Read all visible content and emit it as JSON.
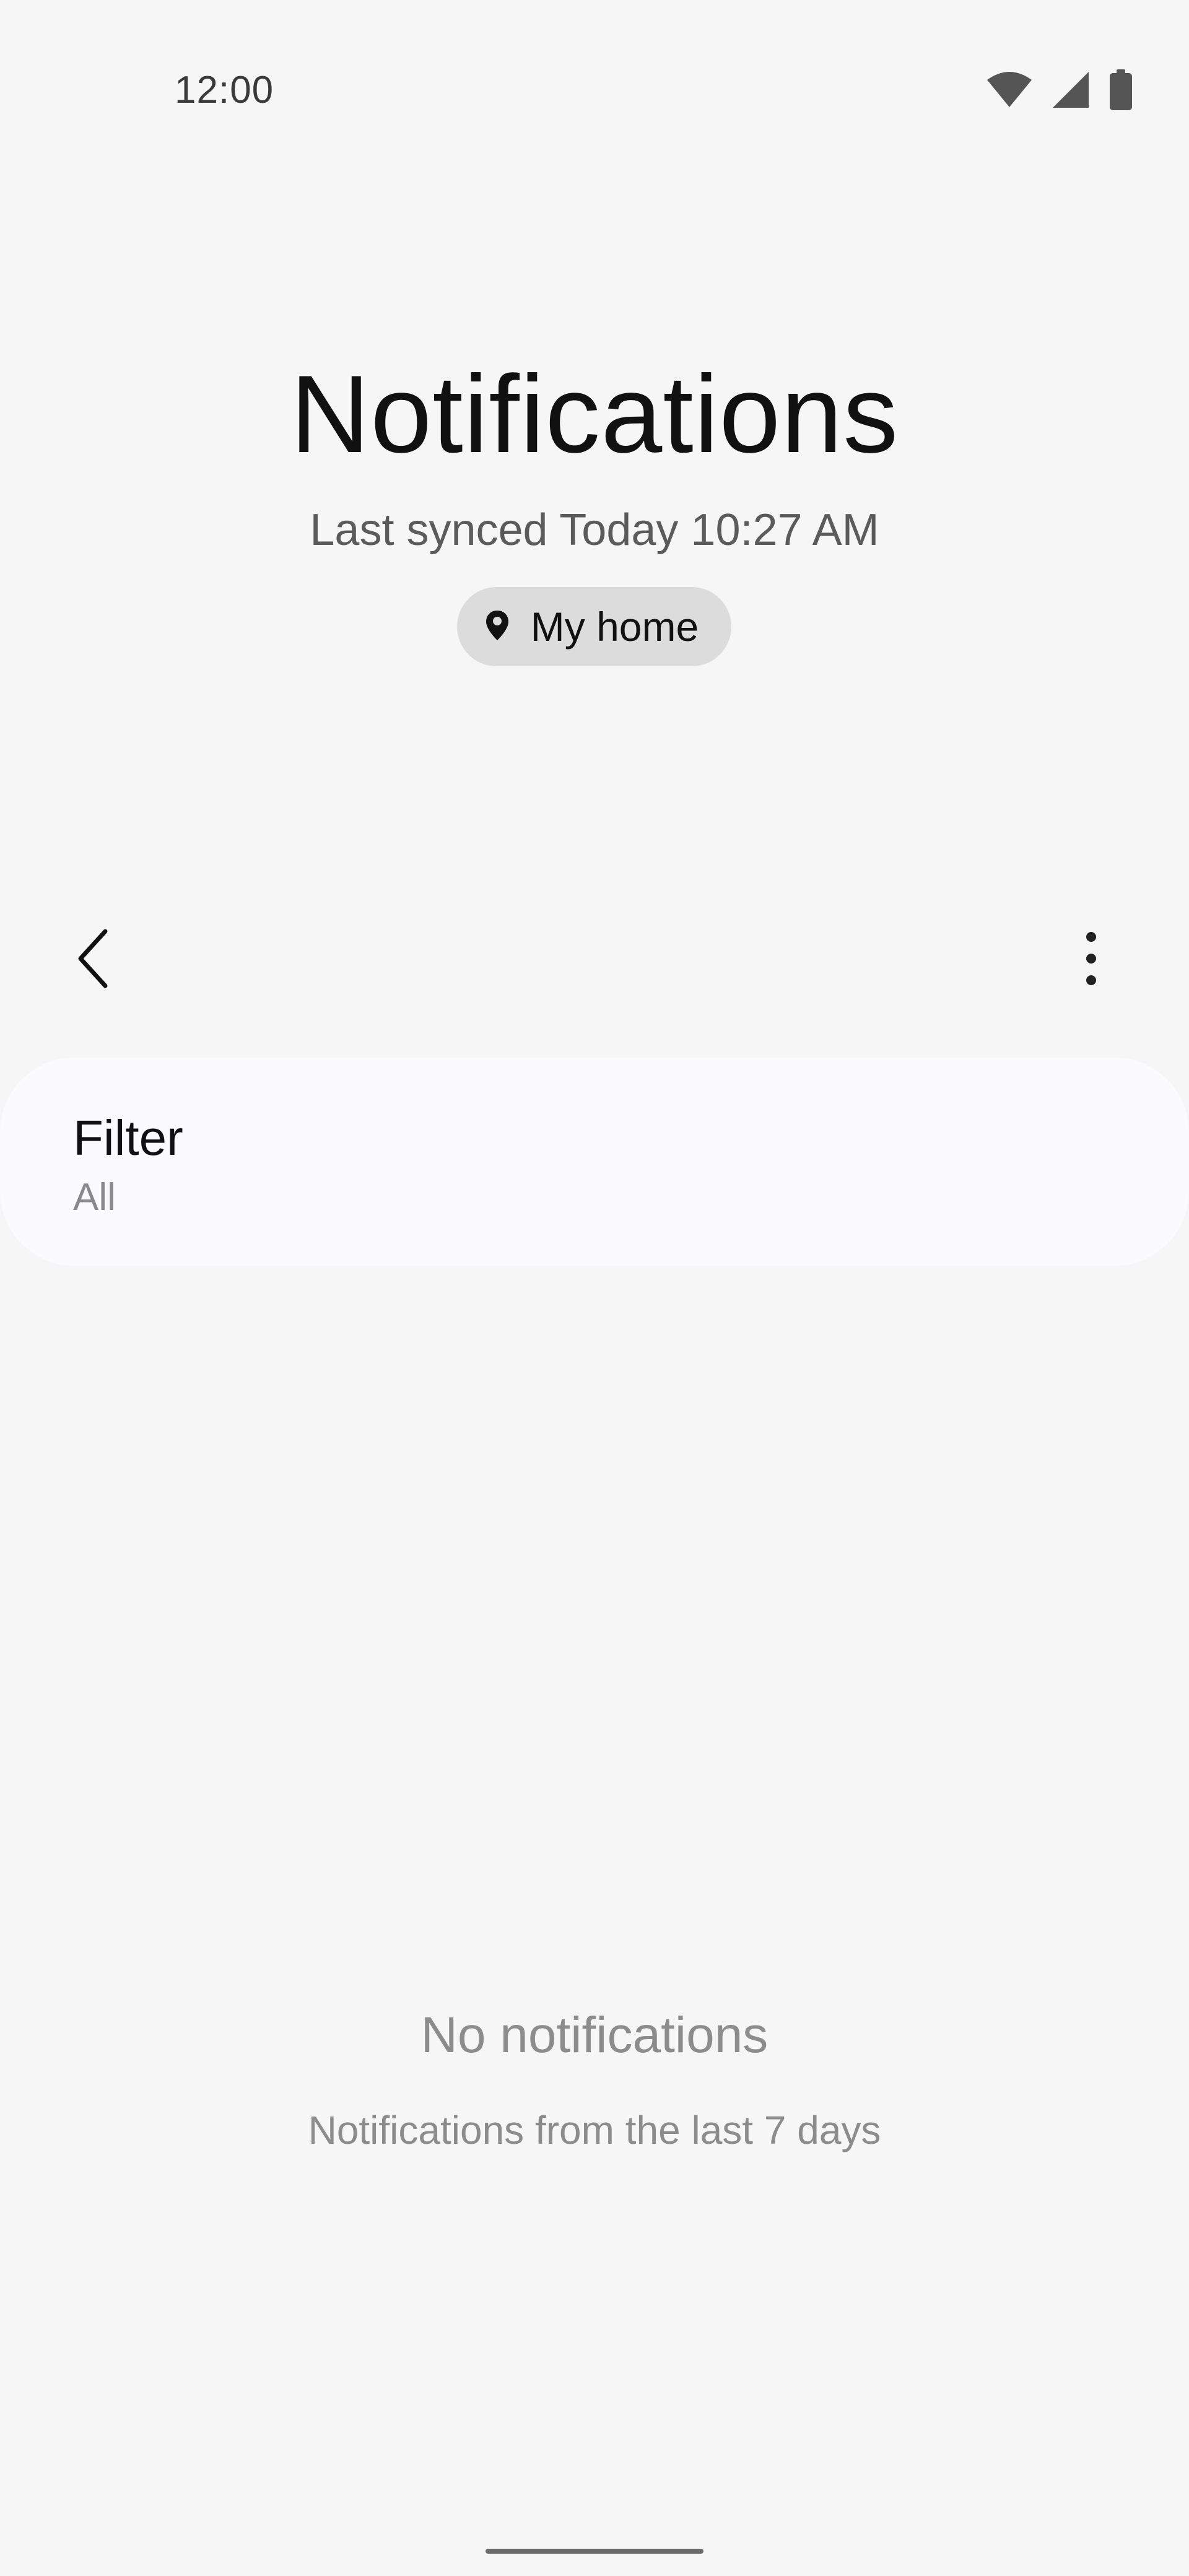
{
  "status_bar": {
    "time": "12:00",
    "icons": [
      "wifi-icon",
      "signal-icon",
      "battery-icon"
    ]
  },
  "header": {
    "title": "Notifications",
    "sync_text": "Last synced Today 10:27 AM",
    "location_chip": {
      "icon": "location-pin-icon",
      "label": "My home"
    }
  },
  "toolbar": {
    "back_icon": "back-chevron-icon",
    "more_icon": "more-vertical-icon"
  },
  "filter": {
    "title": "Filter",
    "value": "All"
  },
  "empty_state": {
    "title": "No notifications",
    "subtitle": "Notifications from the last 7 days"
  },
  "colors": {
    "background": "#f6f6f6",
    "card": "#fbfbfd",
    "chip": "#dcdcdc",
    "muted_text": "#8c8c8c"
  }
}
